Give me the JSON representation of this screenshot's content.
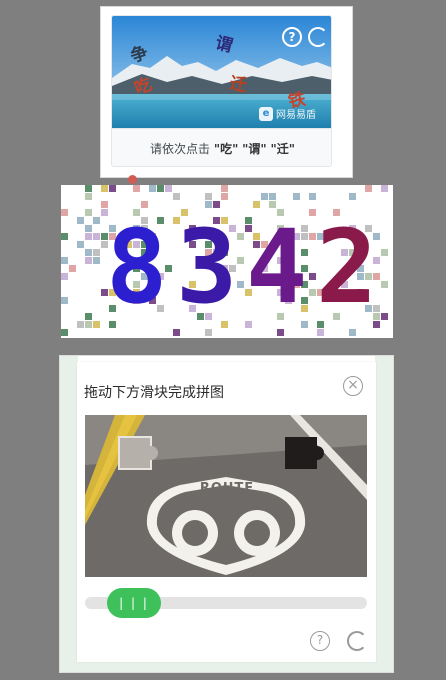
{
  "click_captcha": {
    "instruction_prefix": "请依次点击",
    "targets": [
      "\"吃\"",
      "\"谓\"",
      "\"迁\""
    ],
    "scene_chars": [
      "争",
      "谓",
      "吃",
      "迁",
      "铁"
    ],
    "brand": "网易易盾",
    "help_icon": "question-icon",
    "refresh_icon": "refresh-icon",
    "accent": "#1e88e5"
  },
  "numeric_captcha": {
    "digits": [
      "8",
      "3",
      "4",
      "2"
    ],
    "colors": [
      "#2b1fcf",
      "#3a1aa6",
      "#6a1a8a",
      "#8a1a4a"
    ]
  },
  "slider_captcha": {
    "title": "拖动下方滑块完成拼图",
    "close_icon": "close-circle-icon",
    "road_text": "ROUTE",
    "road_number": "66",
    "knob_label": "| | |",
    "accent": "#3ec15a",
    "help_icon": "question-icon",
    "refresh_icon": "refresh-icon"
  }
}
